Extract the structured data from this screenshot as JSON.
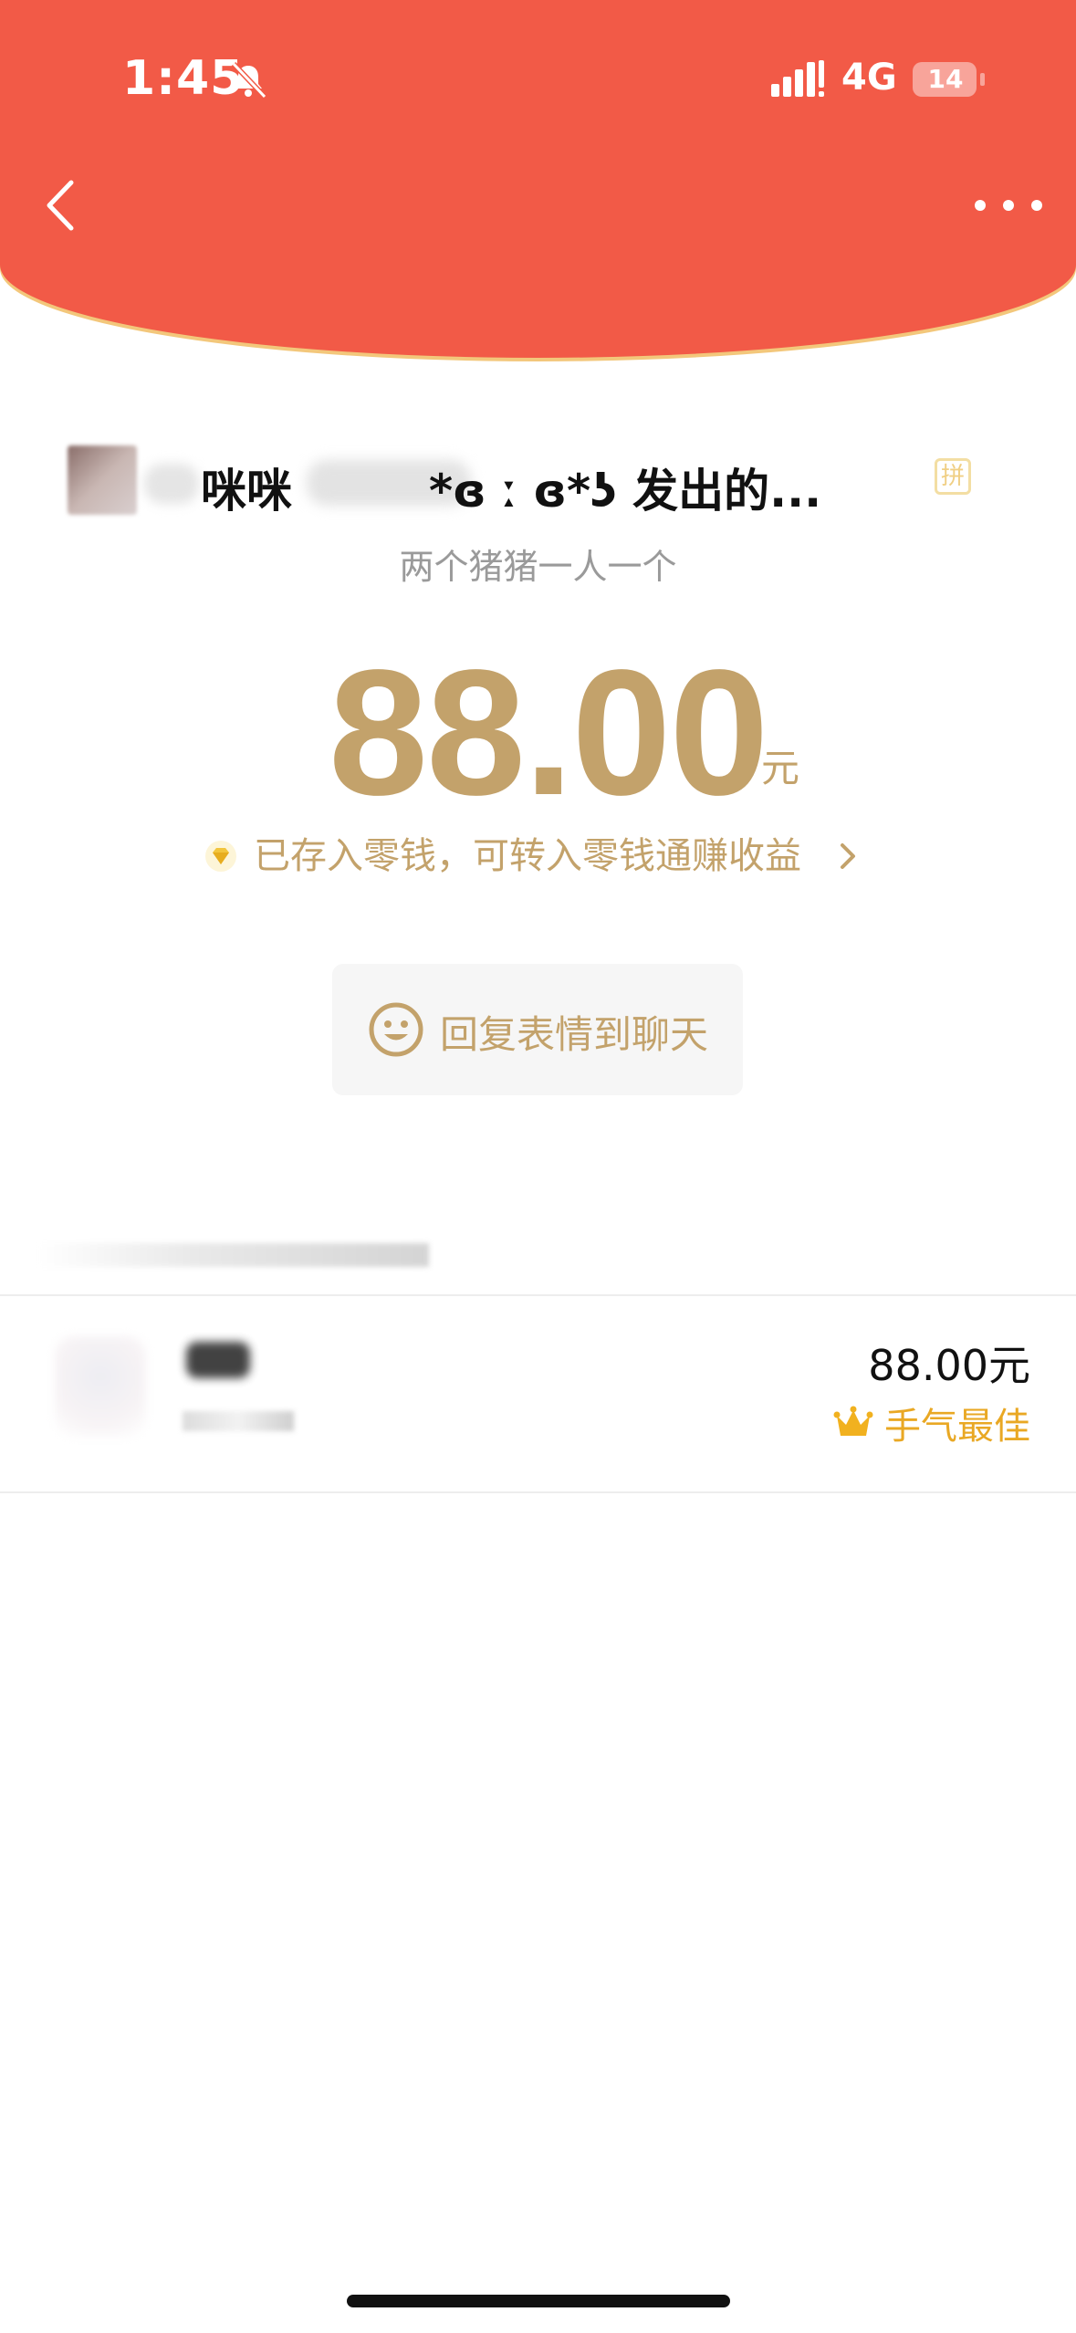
{
  "status_bar": {
    "time": "1:45",
    "network": "4G",
    "battery": "14"
  },
  "packet": {
    "sender_name_part1": "咪咪",
    "sender_name_part2": "*ɞ ː ɞ*ʖ 发出的...",
    "pin_badge": "拼",
    "greeting": "两个猪猪一人一个",
    "amount": "88.00",
    "unit": "元",
    "wallet_text": "已存入零钱，可转入零钱通赚收益",
    "reply_label": "回复表情到聊天"
  },
  "records": [
    {
      "amount": "88.00元",
      "badge": "手气最佳"
    }
  ],
  "colors": {
    "header_red": "#f25a47",
    "gold": "#c3a26b",
    "best_orange": "#e9a824"
  }
}
